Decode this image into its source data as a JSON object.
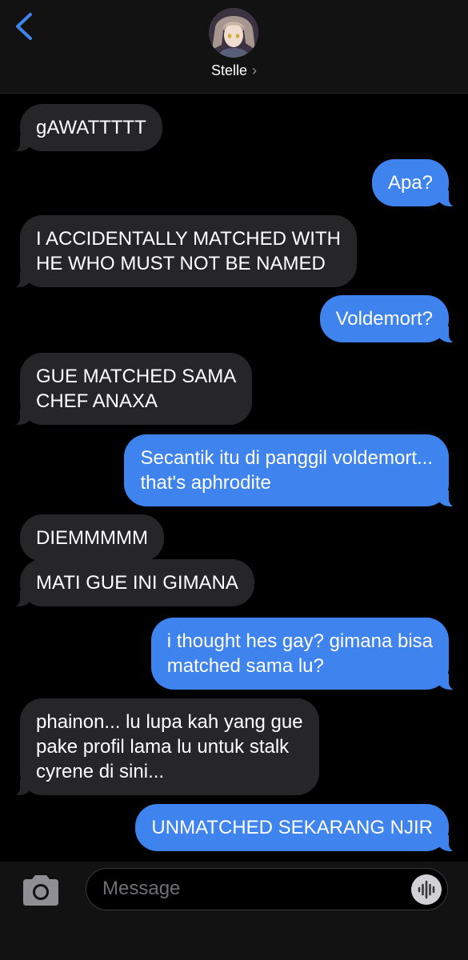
{
  "header": {
    "back_icon": "chevron-left-icon",
    "contact_name": "Stelle",
    "contact_chevron": "›",
    "accent_color": "#3e83ee"
  },
  "messages": [
    {
      "direction": "incoming",
      "text": "gAWATTTTT"
    },
    {
      "direction": "outgoing",
      "text": "Apa?"
    },
    {
      "direction": "incoming",
      "text": "I ACCIDENTALLY MATCHED WITH\nHE WHO MUST NOT BE NAMED"
    },
    {
      "direction": "outgoing",
      "text": "Voldemort?"
    },
    {
      "direction": "incoming",
      "text": "GUE MATCHED SAMA\nCHEF ANAXA"
    },
    {
      "direction": "outgoing",
      "text": "Secantik itu di panggil voldemort...\nthat's aphrodite"
    },
    {
      "direction": "incoming",
      "text": "DIEMMMMM"
    },
    {
      "direction": "incoming",
      "text": "MATI GUE INI GIMANA"
    },
    {
      "direction": "outgoing",
      "text": "i thought hes gay? gimana bisa\nmatched sama lu?"
    },
    {
      "direction": "incoming",
      "text": "phainon... lu lupa kah yang gue\npake profil lama lu untuk stalk\ncyrene di sini..."
    },
    {
      "direction": "outgoing",
      "text": "UNMATCHED SEKARANG NJIR"
    }
  ],
  "composer": {
    "camera_icon": "camera-icon",
    "placeholder": "Message",
    "audio_icon": "audio-waveform-icon"
  },
  "colors": {
    "incoming_bubble": "#262629",
    "outgoing_bubble": "#3e83ee",
    "background": "#000000",
    "bar": "#121212"
  }
}
